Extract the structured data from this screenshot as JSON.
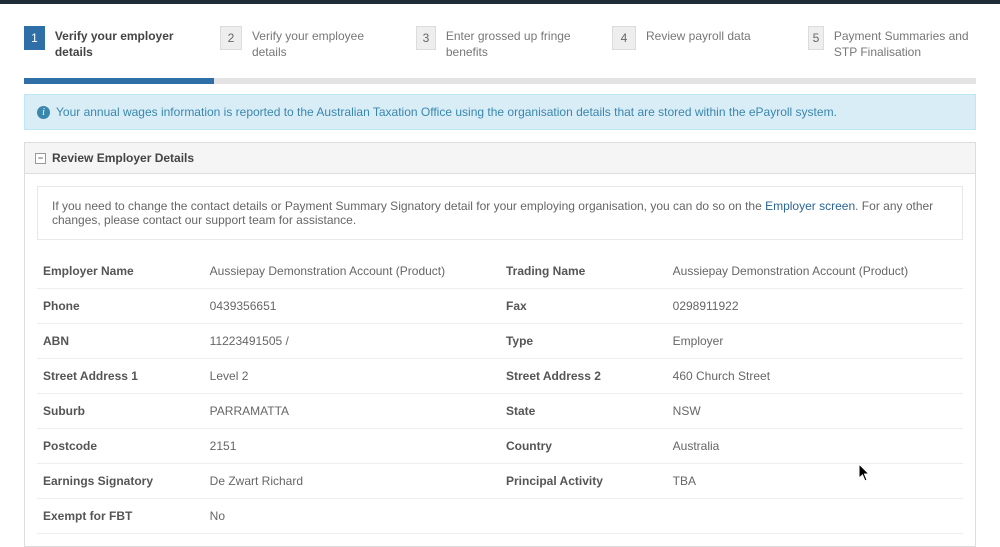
{
  "wizard": {
    "steps": [
      {
        "num": "1",
        "label": "Verify your employer details"
      },
      {
        "num": "2",
        "label": "Verify your employee details"
      },
      {
        "num": "3",
        "label": "Enter grossed up fringe benefits"
      },
      {
        "num": "4",
        "label": "Review payroll data"
      },
      {
        "num": "5",
        "label": "Payment Summaries and STP Finalisation"
      }
    ],
    "active_index": 0,
    "progress_percent": 20
  },
  "info_banner": {
    "text": "Your annual wages information is reported to the Australian Taxation Office using the organisation details that are stored within the ePayroll system."
  },
  "panel": {
    "title": "Review Employer Details",
    "help_prefix": "If you need to change the contact details or Payment Summary Signatory detail for your employing organisation, you can do so on the ",
    "help_link_text": "Employer screen",
    "help_suffix": ". For any other changes, please contact our support team for assistance."
  },
  "employer": {
    "employer_name_label": "Employer Name",
    "employer_name": "Aussiepay Demonstration Account (Product)",
    "trading_name_label": "Trading Name",
    "trading_name": "Aussiepay Demonstration Account (Product)",
    "phone_label": "Phone",
    "phone": "0439356651",
    "fax_label": "Fax",
    "fax": "0298911922",
    "abn_label": "ABN",
    "abn": "11223491505 /",
    "type_label": "Type",
    "type": "Employer",
    "street1_label": "Street Address 1",
    "street1": "Level 2",
    "street2_label": "Street Address 2",
    "street2": "460 Church Street",
    "suburb_label": "Suburb",
    "suburb": "PARRAMATTA",
    "state_label": "State",
    "state": "NSW",
    "postcode_label": "Postcode",
    "postcode": "2151",
    "country_label": "Country",
    "country": "Australia",
    "earnings_sig_label": "Earnings Signatory",
    "earnings_sig": "De Zwart Richard",
    "principal_activity_label": "Principal Activity",
    "principal_activity": "TBA",
    "exempt_fbt_label": "Exempt for FBT",
    "exempt_fbt": "No"
  }
}
